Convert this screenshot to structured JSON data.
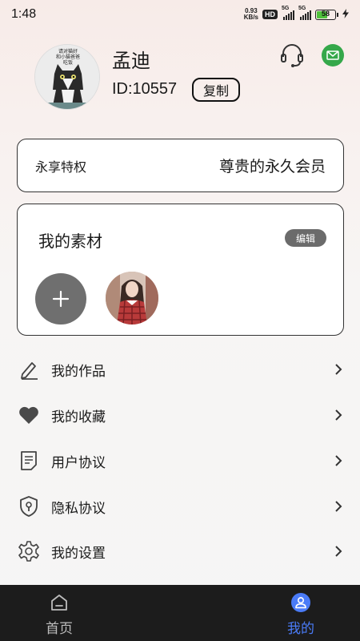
{
  "status_bar": {
    "time": "1:48",
    "net_speed_value": "0.93",
    "net_speed_unit": "KB/s",
    "hd_label": "HD",
    "signal1_label": "5G",
    "signal2_label": "5G",
    "battery_level": "58",
    "icons": [
      "hd-icon",
      "signal-icon",
      "battery-icon",
      "charging-icon"
    ]
  },
  "profile": {
    "name": "孟迪",
    "id_text": "ID:10557",
    "copy_label": "复制",
    "avatar_caption_lines": [
      "请对猫好",
      "和小猫爸爸",
      "吃饭"
    ],
    "icons": [
      "headset-icon",
      "message-icon"
    ]
  },
  "vip": {
    "label": "永享特权",
    "value": "尊贵的永久会员"
  },
  "materials": {
    "title": "我的素材",
    "edit_label": "编辑",
    "add_icon": "plus-icon"
  },
  "menu": [
    {
      "label": "我的作品",
      "icon": "pencil-icon"
    },
    {
      "label": "我的收藏",
      "icon": "heart-icon"
    },
    {
      "label": "用户协议",
      "icon": "document-icon"
    },
    {
      "label": "隐私协议",
      "icon": "shield-icon"
    },
    {
      "label": "我的设置",
      "icon": "gear-icon"
    }
  ],
  "bottom_nav": [
    {
      "label": "首页",
      "icon": "home-icon",
      "active": false
    },
    {
      "label": "我的",
      "icon": "user-icon",
      "active": true
    }
  ],
  "colors": {
    "accent": "#4a7bf7",
    "nav_background": "#1c1c1c",
    "nav_inactive": "#bdbdbd",
    "message_green": "#35a84a",
    "edit_button": "#6b6b6b"
  }
}
